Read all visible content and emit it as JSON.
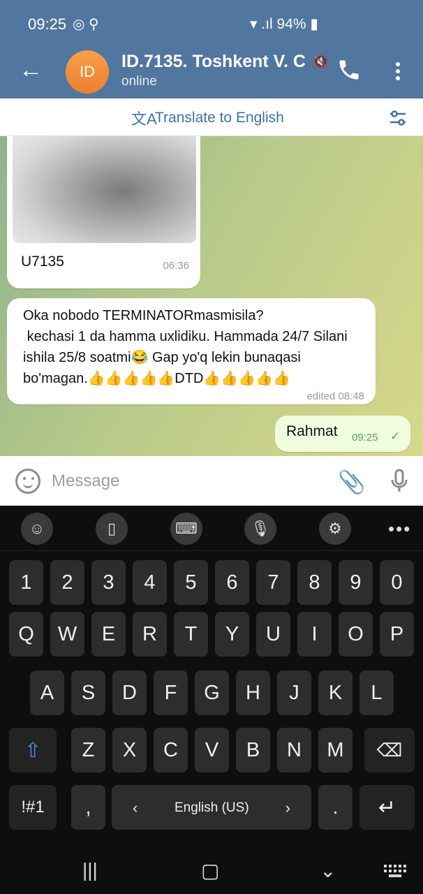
{
  "status": {
    "time": "09:25",
    "battery": "94%"
  },
  "header": {
    "title": "ID.7135. Toshkent V. C",
    "avatar_initials": "ID",
    "subtitle": "online"
  },
  "translate": {
    "label": "Translate to English"
  },
  "messages": [
    {
      "type": "image",
      "caption": "U7135",
      "time": "06:36"
    },
    {
      "type": "text",
      "text": "Oka nobodo TERMINATORmasmisila?\n kechasi 1 da hamma uxlidiku. Hammada 24/7 Silani ishila 25/8 soatmi😂 Gap yo'q lekin bunaqasi bo'magan.👍👍👍👍👍DTD👍👍👍👍👍",
      "time": "edited 08:48"
    },
    {
      "type": "outgoing",
      "text": "Rahmat",
      "time": "09:25",
      "status_icon": "check-icon"
    }
  ],
  "composer": {
    "placeholder": "Message"
  },
  "keyboard": {
    "row_numbers": [
      "1",
      "2",
      "3",
      "4",
      "5",
      "6",
      "7",
      "8",
      "9",
      "0"
    ],
    "row_q": [
      "Q",
      "W",
      "E",
      "R",
      "T",
      "Y",
      "U",
      "I",
      "O",
      "P"
    ],
    "row_a": [
      "A",
      "S",
      "D",
      "F",
      "G",
      "H",
      "J",
      "K",
      "L"
    ],
    "row_z": [
      "Z",
      "X",
      "C",
      "V",
      "B",
      "N",
      "M"
    ],
    "symbols_label": "!#1",
    "comma": ",",
    "period": ".",
    "space_label": "English (US)"
  },
  "colors": {
    "header": "#51769f",
    "accent": "#3d72a6",
    "outgoing": "#effdde"
  }
}
